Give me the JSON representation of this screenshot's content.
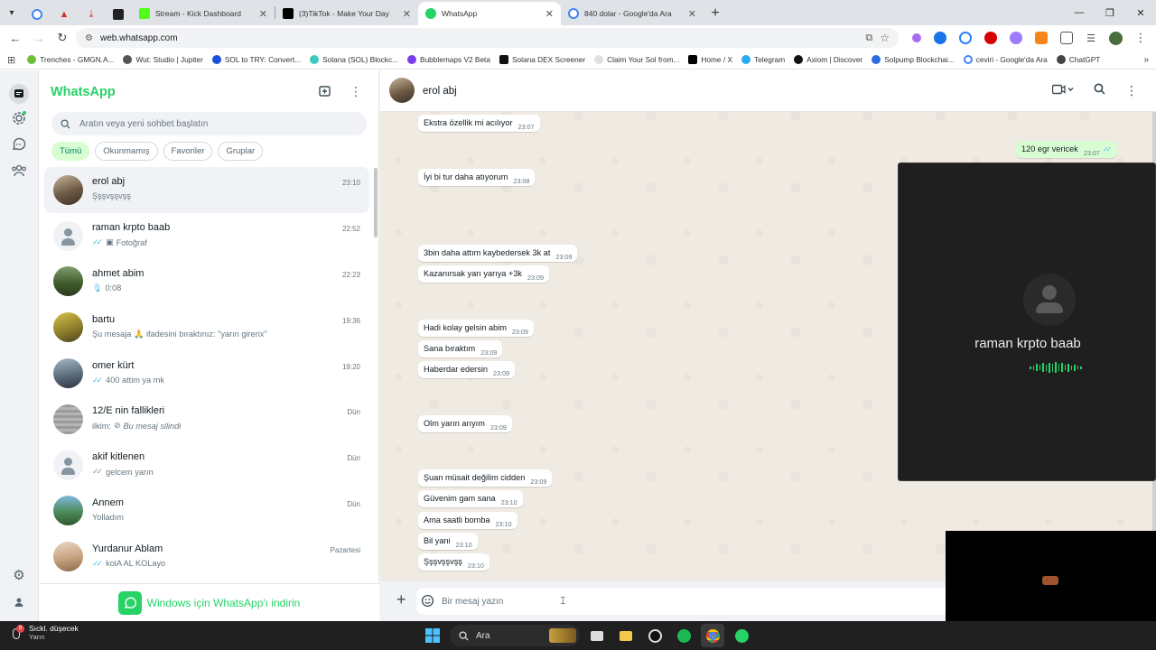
{
  "browser": {
    "tabs": [
      {
        "title": "Stream - Kick Dashboard",
        "active": false
      },
      {
        "title": "(3)TikTok - Make Your Day",
        "active": false
      },
      {
        "title": "WhatsApp",
        "active": true
      },
      {
        "title": "840 dolar - Google'da Ara",
        "active": false
      }
    ],
    "url": "web.whatsapp.com",
    "bookmarks": [
      "Trenches - GMGN.A...",
      "Wut: Studio | Jupiter",
      "SOL to TRY: Convert...",
      "Solana (SOL) Blockc...",
      "Bubblemaps V2 Beta",
      "Solana DEX Screener",
      "Claim Your Sol from...",
      "Home / X",
      "Telegram",
      "Axiom | Discover",
      "Solpump Blockchai...",
      "ceviri - Google'da Ara",
      "ChatGPT"
    ]
  },
  "whatsapp": {
    "brand": "WhatsApp",
    "search_placeholder": "Aratın veya yeni sohbet başlatın",
    "filters": [
      "Tümü",
      "Okunmamış",
      "Favoriler",
      "Gruplar"
    ],
    "chats": [
      {
        "name": "erol abj",
        "preview": "Şşşvşşvşş",
        "time": "23:10",
        "ticks": false
      },
      {
        "name": "raman krpto baab",
        "preview": "Fotoğraf",
        "time": "22:52",
        "ticks": true
      },
      {
        "name": "ahmet abim",
        "preview": "0:08",
        "time": "22:23",
        "ticks": false
      },
      {
        "name": "bartu",
        "preview": "Şu mesaja 🙏 ifadesini bıraktınız: \"yarın girerix\"",
        "time": "19:36",
        "ticks": false
      },
      {
        "name": "omer kürt",
        "preview": "400 attim ya mk",
        "time": "19:20",
        "ticks": true
      },
      {
        "name": "12/E nin fallikleri",
        "preview": "Bu mesaj silindi",
        "preview_prefix": "ilkim:",
        "time": "Dün",
        "ticks": false
      },
      {
        "name": "akif kitlenen",
        "preview": "gelcem yarın",
        "time": "Dün",
        "ticks": true
      },
      {
        "name": "Annem",
        "preview": "Yolladım",
        "time": "Dün",
        "ticks": false
      },
      {
        "name": "Yurdanur Ablam",
        "preview": "kolA AL KOLayo",
        "time": "Pazartesi",
        "ticks": true
      }
    ],
    "promo": "Windows için WhatsApp'ı indirin",
    "active_chat": {
      "name": "erol abj",
      "messages": [
        {
          "text": "Ekstra özellik mi acılıyor",
          "time": "23:07",
          "dir": "in"
        },
        {
          "text": "120 egr vericek",
          "time": "23:07",
          "dir": "out"
        },
        {
          "text": "İyi bi tur daha atıyorum",
          "time": "23:08",
          "dir": "in"
        },
        {
          "text": "3bin daha attım kaybedersek 3k at",
          "time": "23:09",
          "dir": "in"
        },
        {
          "text": "Kazanırsak yarı yarıya +3k",
          "time": "23:09",
          "dir": "in"
        },
        {
          "text": "Hadi kolay gelsin abim",
          "time": "23:09",
          "dir": "in"
        },
        {
          "text": "Sana bıraktım",
          "time": "23:09",
          "dir": "in"
        },
        {
          "text": "Haberdar edersin",
          "time": "23:09",
          "dir": "in"
        },
        {
          "text": "Olm yarın arıyım",
          "time": "23:09",
          "dir": "in"
        },
        {
          "text": "Şuan müsait değilim cidden",
          "time": "23:09",
          "dir": "in"
        },
        {
          "text": "Güvenim gam sana",
          "time": "23:10",
          "dir": "in"
        },
        {
          "text": "Ama saatli bomba",
          "time": "23:10",
          "dir": "in"
        },
        {
          "text": "Bil yani",
          "time": "23:10",
          "dir": "in"
        },
        {
          "text": "Şşşvşşvşş",
          "time": "23:10",
          "dir": "in"
        }
      ],
      "composer_placeholder": "Bir mesaj yazın"
    },
    "call": {
      "name": "raman krpto baab"
    }
  },
  "taskbar": {
    "weather_title": "Sıckl. düşecek",
    "weather_sub": "Yarın",
    "weather_badge": "9",
    "search_label": "Ara"
  },
  "colors": {
    "brand_green": "#25d366",
    "outgoing_bubble": "#d9fdd3",
    "chat_bg": "#efeae2"
  }
}
